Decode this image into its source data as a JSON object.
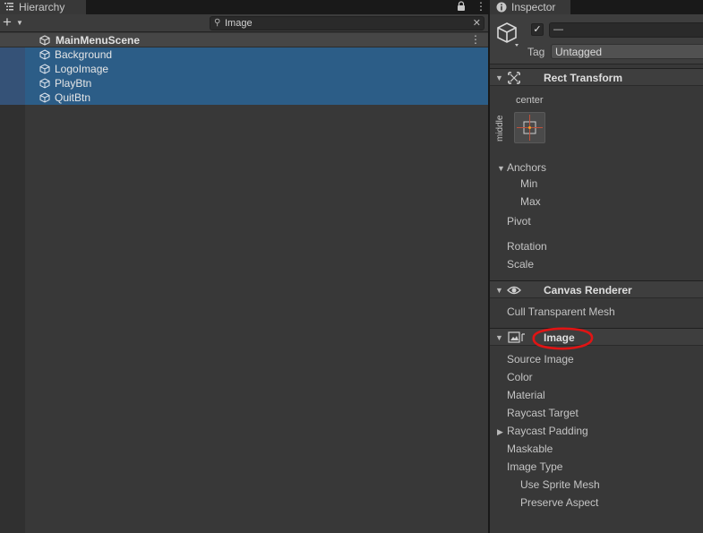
{
  "hierarchy": {
    "tab_title": "Hierarchy",
    "search_value": "Image",
    "scene_name": "MainMenuScene",
    "items": [
      {
        "label": "Background"
      },
      {
        "label": "LogoImage"
      },
      {
        "label": "PlayBtn"
      },
      {
        "label": "QuitBtn"
      }
    ]
  },
  "inspector": {
    "tab_title": "Inspector",
    "object_name": "—",
    "tag_label": "Tag",
    "tag_value": "Untagged",
    "rect_transform": {
      "title": "Rect Transform",
      "anchor_preset_h": "center",
      "anchor_preset_v": "middle",
      "anchors": "Anchors",
      "min": "Min",
      "max": "Max",
      "pivot": "Pivot",
      "rotation": "Rotation",
      "scale": "Scale"
    },
    "canvas_renderer": {
      "title": "Canvas Renderer",
      "cull": "Cull Transparent Mesh"
    },
    "image": {
      "title": "Image",
      "source_image": "Source Image",
      "color": "Color",
      "material": "Material",
      "raycast_target": "Raycast Target",
      "raycast_padding": "Raycast Padding",
      "maskable": "Maskable",
      "image_type": "Image Type",
      "use_sprite_mesh": "Use Sprite Mesh",
      "preserve_aspect": "Preserve Aspect"
    }
  },
  "colors": {
    "selection": "#2c5d87",
    "annotation": "#e01414"
  }
}
